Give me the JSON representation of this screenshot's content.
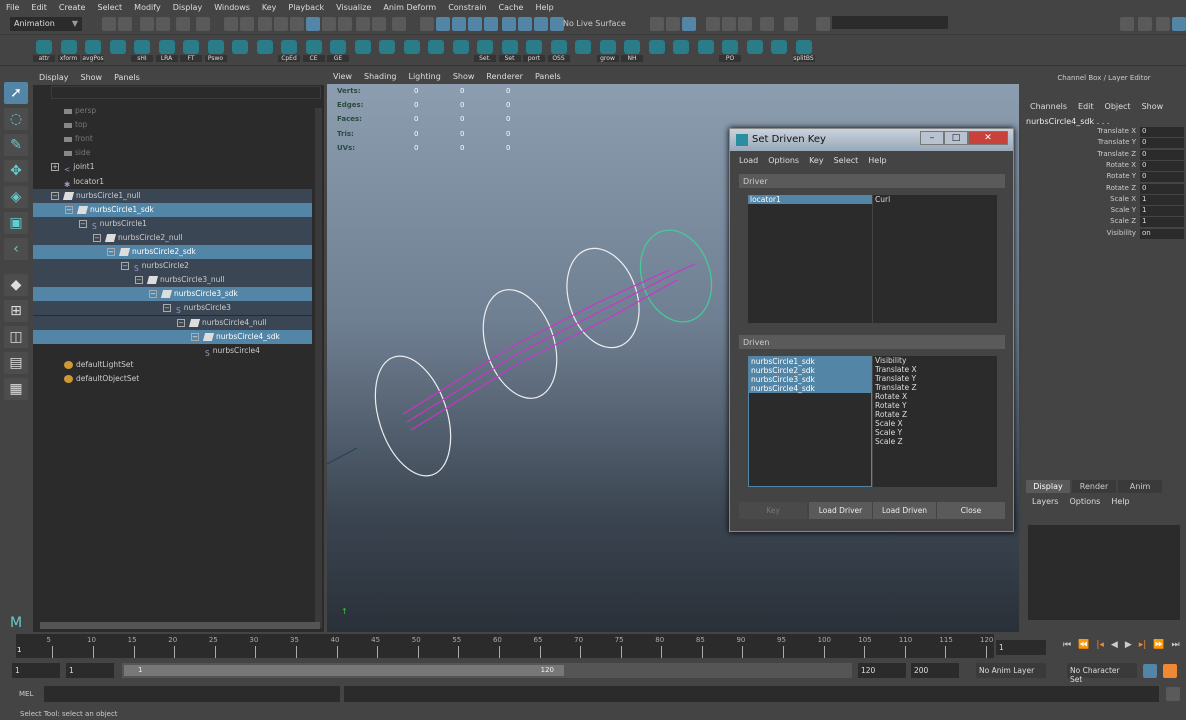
{
  "menubar": [
    "File",
    "Edit",
    "Create",
    "Select",
    "Modify",
    "Display",
    "Windows",
    "Key",
    "Playback",
    "Visualize",
    "Anim Deform",
    "Constrain",
    "Cache",
    "Help"
  ],
  "status": {
    "mode": "Animation",
    "live_surface": "No Live Surface"
  },
  "shelf": [
    "attr",
    "xform",
    "avgPos",
    "",
    "sHI",
    "LRA",
    "FT",
    "Pswo",
    "",
    "",
    "CpEd",
    "CE",
    "GE",
    "",
    "",
    "",
    "",
    "",
    "Set.",
    "Set",
    "port",
    "OSS",
    "",
    "grow",
    "NH",
    "",
    "",
    "",
    "PO",
    "",
    "",
    "splitBS"
  ],
  "outliner": {
    "menu": [
      "Display",
      "Show",
      "Panels"
    ],
    "items": [
      {
        "label": "persp",
        "depth": 0,
        "icon": "camera",
        "state": "dim"
      },
      {
        "label": "top",
        "depth": 0,
        "icon": "camera",
        "state": "dim"
      },
      {
        "label": "front",
        "depth": 0,
        "icon": "camera",
        "state": "dim"
      },
      {
        "label": "side",
        "depth": 0,
        "icon": "camera",
        "state": "dim"
      },
      {
        "label": "joint1",
        "depth": 0,
        "icon": "joint",
        "exp": "+"
      },
      {
        "label": "locator1",
        "depth": 0,
        "icon": "locator"
      },
      {
        "label": "nurbsCircle1_null",
        "depth": 0,
        "icon": "xform",
        "exp": "-",
        "state": "hl"
      },
      {
        "label": "nurbsCircle1_sdk",
        "depth": 1,
        "icon": "xform",
        "exp": "-",
        "state": "sel"
      },
      {
        "label": "nurbsCircle1",
        "depth": 2,
        "icon": "curve",
        "exp": "-",
        "state": "hl"
      },
      {
        "label": "nurbsCircle2_null",
        "depth": 3,
        "icon": "xform",
        "exp": "-",
        "state": "hl"
      },
      {
        "label": "nurbsCircle2_sdk",
        "depth": 4,
        "icon": "xform",
        "exp": "-",
        "state": "sel"
      },
      {
        "label": "nurbsCircle2",
        "depth": 5,
        "icon": "curve",
        "exp": "-",
        "state": "hl"
      },
      {
        "label": "nurbsCircle3_null",
        "depth": 6,
        "icon": "xform",
        "exp": "-",
        "state": "hl"
      },
      {
        "label": "nurbsCircle3_sdk",
        "depth": 7,
        "icon": "xform",
        "exp": "-",
        "state": "sel"
      },
      {
        "label": "nurbsCircle3",
        "depth": 8,
        "icon": "curve",
        "exp": "-",
        "state": "hl"
      },
      {
        "label": "nurbsCircle4_null",
        "depth": 9,
        "icon": "xform",
        "exp": "-",
        "state": "hl"
      },
      {
        "label": "nurbsCircle4_sdk",
        "depth": 10,
        "icon": "xform",
        "exp": "-",
        "state": "sel"
      },
      {
        "label": "nurbsCircle4",
        "depth": 11,
        "icon": "curve"
      },
      {
        "label": "defaultLightSet",
        "depth": 0,
        "icon": "set"
      },
      {
        "label": "defaultObjectSet",
        "depth": 0,
        "icon": "set"
      }
    ]
  },
  "viewport": {
    "menu": [
      "View",
      "Shading",
      "Lighting",
      "Show",
      "Renderer",
      "Panels"
    ],
    "hud": [
      {
        "label": "Verts:",
        "values": [
          "0",
          "0",
          "0"
        ]
      },
      {
        "label": "Edges:",
        "values": [
          "0",
          "0",
          "0"
        ]
      },
      {
        "label": "Faces:",
        "values": [
          "0",
          "0",
          "0"
        ]
      },
      {
        "label": "Tris:",
        "values": [
          "0",
          "0",
          "0"
        ]
      },
      {
        "label": "UVs:",
        "values": [
          "0",
          "0",
          "0"
        ]
      }
    ]
  },
  "dialog": {
    "title": "Set Driven Key",
    "menu": [
      "Load",
      "Options",
      "Key",
      "Select",
      "Help"
    ],
    "driver_label": "Driver",
    "driver_objects": [
      "locator1"
    ],
    "driver_attrs": [
      "Curl"
    ],
    "driven_label": "Driven",
    "driven_objects": [
      "nurbsCircle1_sdk",
      "nurbsCircle2_sdk",
      "nurbsCircle3_sdk",
      "nurbsCircle4_sdk"
    ],
    "driven_attrs": [
      "Visibility",
      "Translate X",
      "Translate Y",
      "Translate Z",
      "Rotate X",
      "Rotate Y",
      "Rotate Z",
      "Scale X",
      "Scale Y",
      "Scale Z"
    ],
    "buttons": {
      "key": "Key",
      "load_driver": "Load Driver",
      "load_driven": "Load Driven",
      "close": "Close"
    }
  },
  "channel_box": {
    "title": "Channel Box / Layer Editor",
    "menu": [
      "Channels",
      "Edit",
      "Object",
      "Show"
    ],
    "object": "nurbsCircle4_sdk . . .",
    "channels": [
      {
        "k": "Translate X",
        "v": "0"
      },
      {
        "k": "Translate Y",
        "v": "0"
      },
      {
        "k": "Translate Z",
        "v": "0"
      },
      {
        "k": "Rotate X",
        "v": "0"
      },
      {
        "k": "Rotate Y",
        "v": "0"
      },
      {
        "k": "Rotate Z",
        "v": "0"
      },
      {
        "k": "Scale X",
        "v": "1"
      },
      {
        "k": "Scale Y",
        "v": "1"
      },
      {
        "k": "Scale Z",
        "v": "1"
      },
      {
        "k": "Visibility",
        "v": "on"
      }
    ]
  },
  "layer_editor": {
    "tabs": [
      "Display",
      "Render",
      "Anim"
    ],
    "menu": [
      "Layers",
      "Options",
      "Help"
    ]
  },
  "timeline": {
    "start": 1,
    "end": 120,
    "current": "1",
    "ticks": [
      5,
      10,
      15,
      20,
      25,
      30,
      35,
      40,
      45,
      50,
      55,
      60,
      65,
      70,
      75,
      80,
      85,
      90,
      95,
      100,
      105,
      110,
      115,
      120
    ]
  },
  "range": {
    "start": "1",
    "anim_start": "1",
    "inner_start": "1",
    "inner_end": "120",
    "end": "120",
    "anim_end": "200",
    "anim_layer": "No Anim Layer",
    "char_set": "No Character Set"
  },
  "command": {
    "label": "MEL"
  },
  "helpline": "Select Tool: select an object"
}
